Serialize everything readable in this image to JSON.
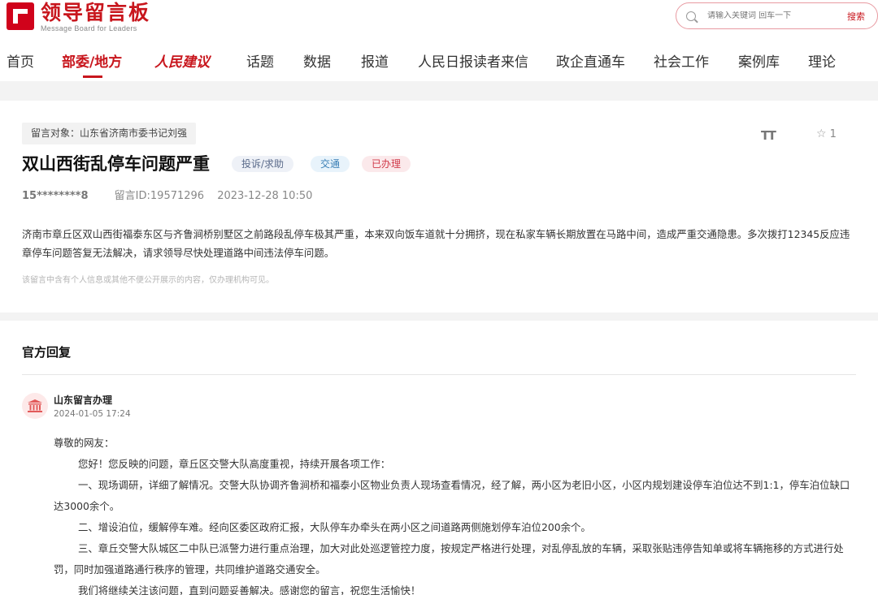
{
  "header": {
    "logo_cn": "领导留言板",
    "logo_en": "Message Board for Leaders",
    "search_placeholder": "请输入关键词 回车一下",
    "search_button": "搜索"
  },
  "nav": [
    {
      "label": "首页"
    },
    {
      "label": "部委/地方"
    },
    {
      "label": "人民建议"
    },
    {
      "label": "话题"
    },
    {
      "label": "数据"
    },
    {
      "label": "报道"
    },
    {
      "label": "人民日报读者来信"
    },
    {
      "label": "政企直通车"
    },
    {
      "label": "社会工作"
    },
    {
      "label": "案例库"
    },
    {
      "label": "理论"
    }
  ],
  "message": {
    "target": "留言对象：山东省济南市委书记刘强",
    "font_icon": "TT",
    "favorite_count": "1",
    "title": "双山西街乱停车问题严重",
    "tags": {
      "type": "投诉/求助",
      "category": "交通",
      "status": "已办理"
    },
    "author": "15********8",
    "message_id": "留言ID:19571296",
    "datetime": "2023-12-28 10:50",
    "content": "济南市章丘区双山西街福泰东区与齐鲁涧桥别墅区之前路段乱停车极其严重，本来双向饭车道就十分拥挤，现在私家车辆长期放置在马路中间，造成严重交通隐患。多次拨打12345反应违章停车问题答复无法解决，请求领导尽快处理道路中间违法停车问题。",
    "note": "该留言中含有个人信息或其他不便公开展示的内容，仅办理机构可见。"
  },
  "reply": {
    "section_title": "官方回复",
    "org_name": "山东留言办理",
    "date": "2024-01-05 17:24",
    "greeting": "尊敬的网友：",
    "p1": "您好！您反映的问题，章丘区交警大队高度重视，持续开展各项工作：",
    "p2": "一、现场调研，详细了解情况。交警大队协调齐鲁涧桥和福泰小区物业负责人现场查看情况，经了解，两小区为老旧小区，小区内规划建设停车泊位达不到1:1，停车泊位缺口达3000余个。",
    "p3": "二、增设泊位，缓解停车难。经向区委区政府汇报，大队停车办牵头在两小区之间道路两侧施划停车泊位200余个。",
    "p4": "三、章丘交警大队城区二中队已派警力进行重点治理，加大对此处巡逻管控力度，按规定严格进行处理，对乱停乱放的车辆，采取张贴违停告知单或将车辆拖移的方式进行处罚，同时加强道路通行秩序的管理，共同维护道路交通安全。",
    "p5": "我们将继续关注该问题，直到问题妥善解决。感谢您的留言，祝您生活愉快！"
  }
}
